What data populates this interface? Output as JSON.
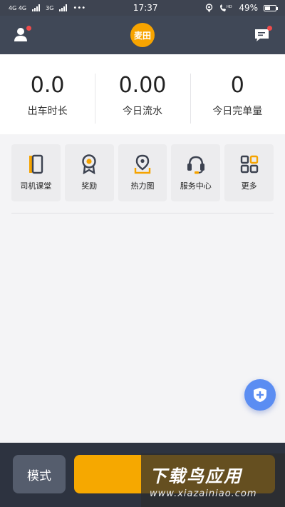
{
  "status_bar": {
    "net1": "4G 4G",
    "net2": "3G",
    "time": "17:37",
    "battery": "49%",
    "battery_level": 0.49
  },
  "header": {
    "logo_text": "麦田",
    "profile_icon": "person-icon",
    "message_icon": "chat-icon"
  },
  "stats": [
    {
      "value": "0.0",
      "label": "出车时长"
    },
    {
      "value": "0.00",
      "label": "今日流水"
    },
    {
      "value": "0",
      "label": "今日完单量"
    }
  ],
  "quick_actions": [
    {
      "label": "司机课堂",
      "icon": "book-icon"
    },
    {
      "label": "奖励",
      "icon": "medal-icon"
    },
    {
      "label": "热力图",
      "icon": "map-pin-icon"
    },
    {
      "label": "服务中心",
      "icon": "headset-icon"
    },
    {
      "label": "更多",
      "icon": "grid-icon"
    }
  ],
  "bottom": {
    "mode_label": "模式",
    "go_label": ""
  },
  "watermark": {
    "main": "下载鸟应用",
    "url": "www.xiazainiao.com"
  },
  "colors": {
    "accent": "#f7a400",
    "header": "#404857",
    "fab": "#5b8df2"
  }
}
